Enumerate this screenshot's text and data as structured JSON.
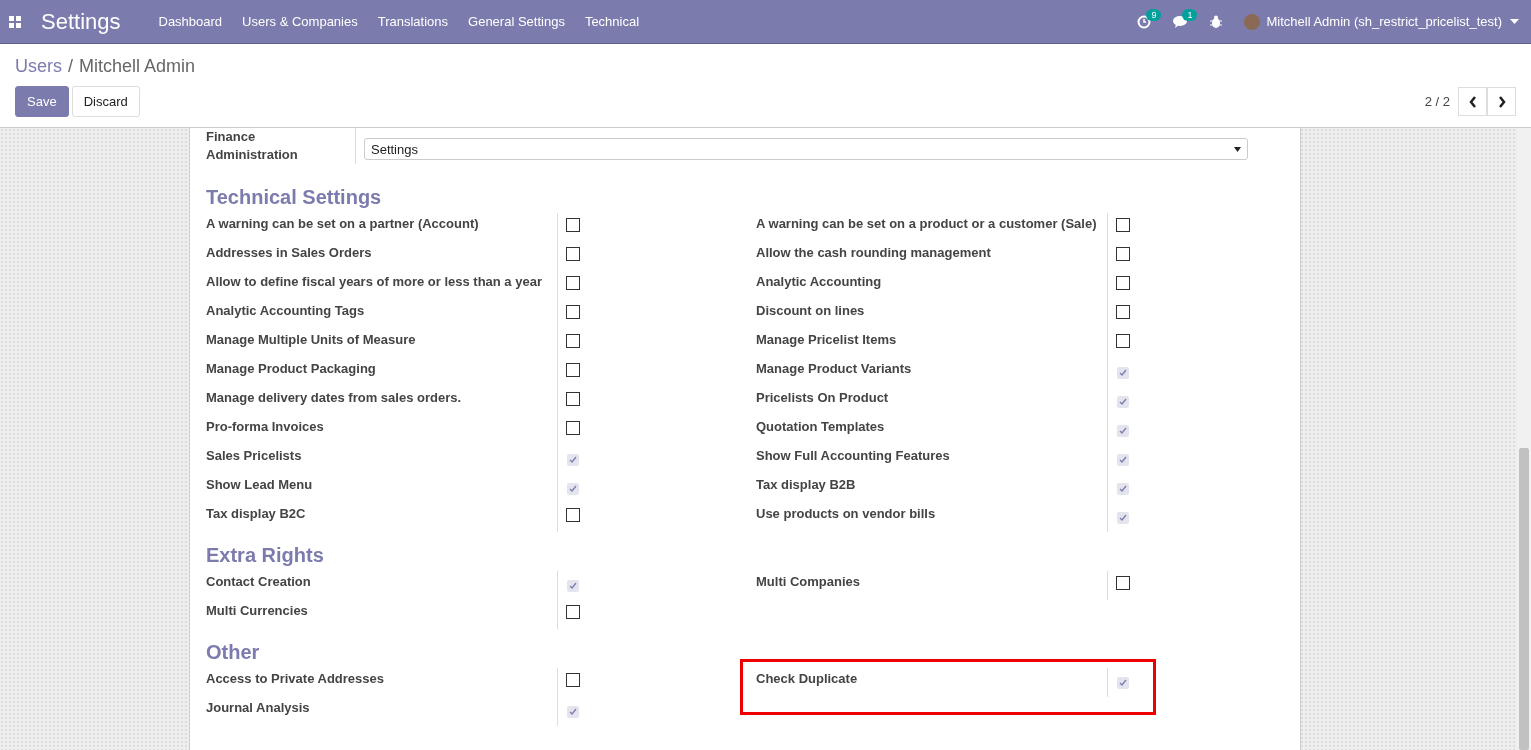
{
  "navbar": {
    "app_title": "Settings",
    "menu": [
      "Dashboard",
      "Users & Companies",
      "Translations",
      "General Settings",
      "Technical"
    ],
    "activity_count": "9",
    "message_count": "1",
    "user": "Mitchell Admin (sh_restrict_pricelist_test)"
  },
  "breadcrumb": {
    "parent": "Users",
    "separator": "/",
    "current": "Mitchell Admin"
  },
  "buttons": {
    "save": "Save",
    "discard": "Discard"
  },
  "pager": {
    "value": "2 / 2"
  },
  "access": {
    "group": "Finance",
    "label": "Administration",
    "value": "Settings"
  },
  "sections": [
    {
      "title": "Technical Settings",
      "left": [
        {
          "label": "A warning can be set on a partner (Account)",
          "checked": false
        },
        {
          "label": "Addresses in Sales Orders",
          "checked": false
        },
        {
          "label": "Allow to define fiscal years of more or less than a year",
          "checked": false
        },
        {
          "label": "Analytic Accounting Tags",
          "checked": false
        },
        {
          "label": "Manage Multiple Units of Measure",
          "checked": false
        },
        {
          "label": "Manage Product Packaging",
          "checked": false
        },
        {
          "label": "Manage delivery dates from sales orders.",
          "checked": false
        },
        {
          "label": "Pro-forma Invoices",
          "checked": false
        },
        {
          "label": "Sales Pricelists",
          "checked": true
        },
        {
          "label": "Show Lead Menu",
          "checked": true
        },
        {
          "label": "Tax display B2C",
          "checked": false
        }
      ],
      "right": [
        {
          "label": "A warning can be set on a product or a customer (Sale)",
          "checked": false
        },
        {
          "label": "Allow the cash rounding management",
          "checked": false
        },
        {
          "label": "Analytic Accounting",
          "checked": false
        },
        {
          "label": "Discount on lines",
          "checked": false
        },
        {
          "label": "Manage Pricelist Items",
          "checked": false
        },
        {
          "label": "Manage Product Variants",
          "checked": true
        },
        {
          "label": "Pricelists On Product",
          "checked": true
        },
        {
          "label": "Quotation Templates",
          "checked": true
        },
        {
          "label": "Show Full Accounting Features",
          "checked": true
        },
        {
          "label": "Tax display B2B",
          "checked": true
        },
        {
          "label": "Use products on vendor bills",
          "checked": true
        }
      ]
    },
    {
      "title": "Extra Rights",
      "left": [
        {
          "label": "Contact Creation",
          "checked": true
        },
        {
          "label": "Multi Currencies",
          "checked": false
        }
      ],
      "right": [
        {
          "label": "Multi Companies",
          "checked": false
        }
      ]
    },
    {
      "title": "Other",
      "left": [
        {
          "label": "Access to Private Addresses",
          "checked": false
        },
        {
          "label": "Journal Analysis",
          "checked": true
        }
      ],
      "right": [
        {
          "label": "Check Duplicate",
          "checked": true,
          "highlighted": true
        }
      ]
    }
  ]
}
